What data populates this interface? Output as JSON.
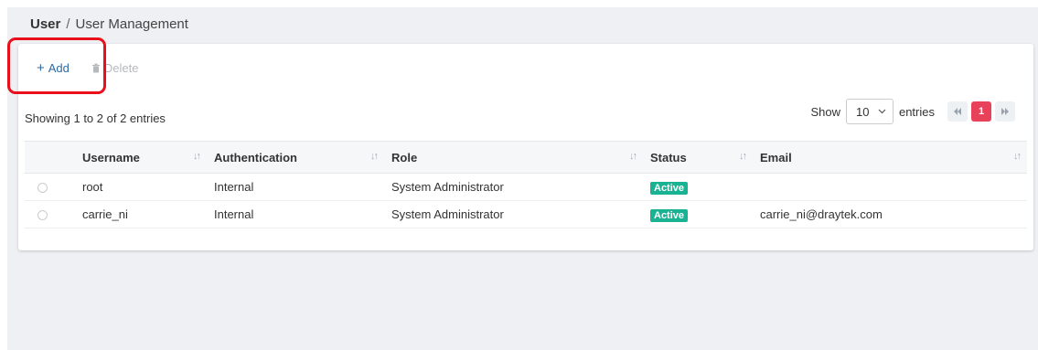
{
  "breadcrumb": {
    "root": "User",
    "separator": "/",
    "current": "User Management"
  },
  "toolbar": {
    "add_label": "Add",
    "delete_label": "Delete"
  },
  "table_info": {
    "showing": "Showing 1 to 2 of 2 entries"
  },
  "length": {
    "show_label": "Show",
    "value": "10",
    "entries_label": "entries"
  },
  "pagination": {
    "current_page": "1"
  },
  "columns": [
    "Username",
    "Authentication",
    "Role",
    "Status",
    "Email"
  ],
  "rows": [
    {
      "username": "root",
      "authentication": "Internal",
      "role": "System Administrator",
      "status": "Active",
      "email": ""
    },
    {
      "username": "carrie_ni",
      "authentication": "Internal",
      "role": "System Administrator",
      "status": "Active",
      "email": "carrie_ni@draytek.com"
    }
  ],
  "colors": {
    "accent": "#2c6aa0",
    "active_badge": "#19b394",
    "current_page": "#e8425a",
    "highlight": "#e8101a"
  },
  "icons": {
    "add": "plus-icon",
    "delete": "trash-icon",
    "sort": "sort-icon",
    "select": "chevron-down-icon",
    "first": "first-page-icon",
    "last": "last-page-icon"
  }
}
